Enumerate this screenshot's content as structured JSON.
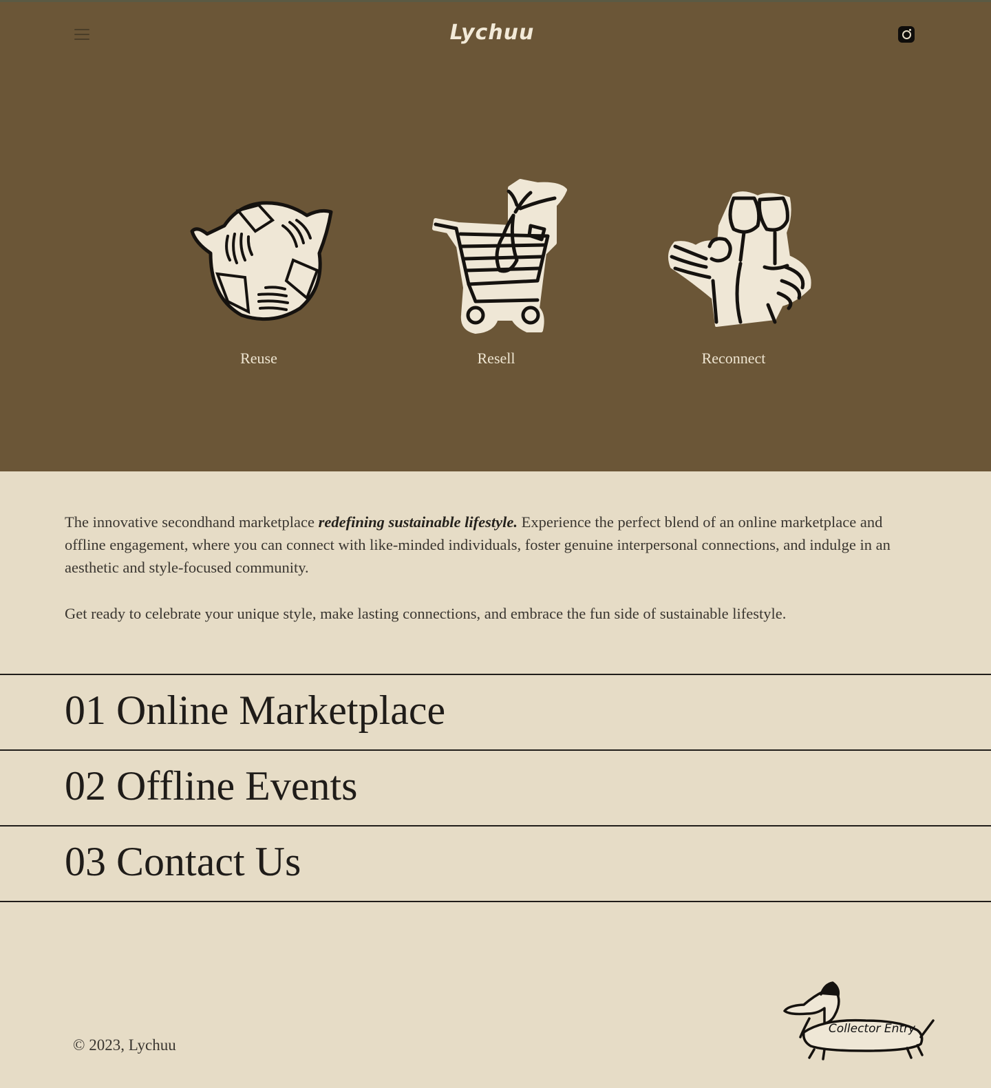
{
  "header": {
    "logo": "Lychuu",
    "menu_icon": "hamburger-menu-icon",
    "social_icon": "instagram-icon"
  },
  "values": [
    {
      "label": "Reuse",
      "icon": "recycle-hands-icon"
    },
    {
      "label": "Resell",
      "icon": "shopping-cart-icon"
    },
    {
      "label": "Reconnect",
      "icon": "wine-glasses-toast-icon"
    }
  ],
  "intro": {
    "p1_start": "The innovative secondhand marketplace ",
    "p1_emphasis": "redefining sustainable lifestyle.",
    "p1_end": " Experience the perfect blend of an online marketplace and offline engagement, where you can connect with like-minded individuals, foster genuine interpersonal connections, and indulge in an aesthetic and style-focused community.",
    "p2": "Get ready to celebrate your unique style, make lasting connections, and embrace the fun side of sustainable lifestyle."
  },
  "sections": [
    {
      "title": "01 Online Marketplace"
    },
    {
      "title": "02 Offline Events"
    },
    {
      "title": "03 Contact Us"
    }
  ],
  "footer": {
    "copyright": "© 2023, Lychuu",
    "collector_label": "Collector Entry",
    "collector_icon": "dachshund-dog-icon"
  },
  "colors": {
    "hero_bg": "#6b5637",
    "page_bg": "#e6dcc6",
    "text_dark": "#1f1c19",
    "label_light": "#efe6d2"
  }
}
